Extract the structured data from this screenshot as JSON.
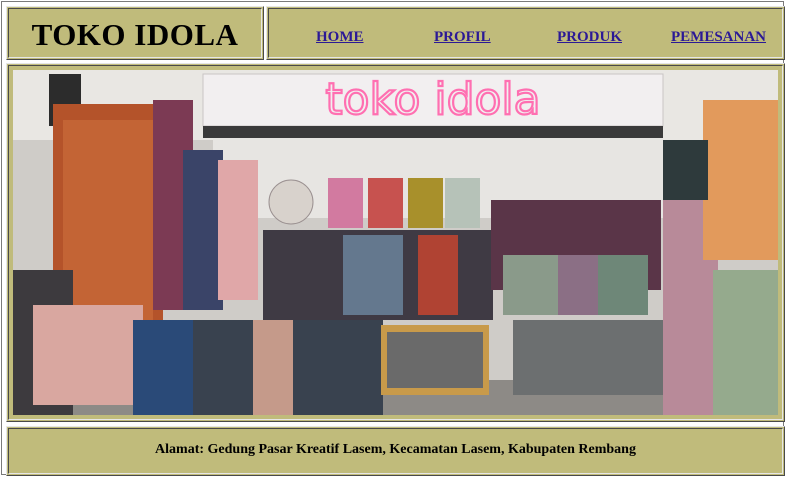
{
  "header": {
    "brand": "TOKO IDOLA"
  },
  "nav": {
    "items": [
      {
        "label": "HOME"
      },
      {
        "label": "PROFIL"
      },
      {
        "label": "PRODUK"
      },
      {
        "label": "PEMESANAN"
      }
    ]
  },
  "hero": {
    "sign_text": "toko idola"
  },
  "footer": {
    "address": "Alamat: Gedung Pasar Kreatif Lasem, Kecamatan Lasem, Kabupaten Rembang"
  },
  "colors": {
    "panel": "#c0bb7b",
    "link": "#2b1996",
    "neon": "#ff6fb1"
  }
}
